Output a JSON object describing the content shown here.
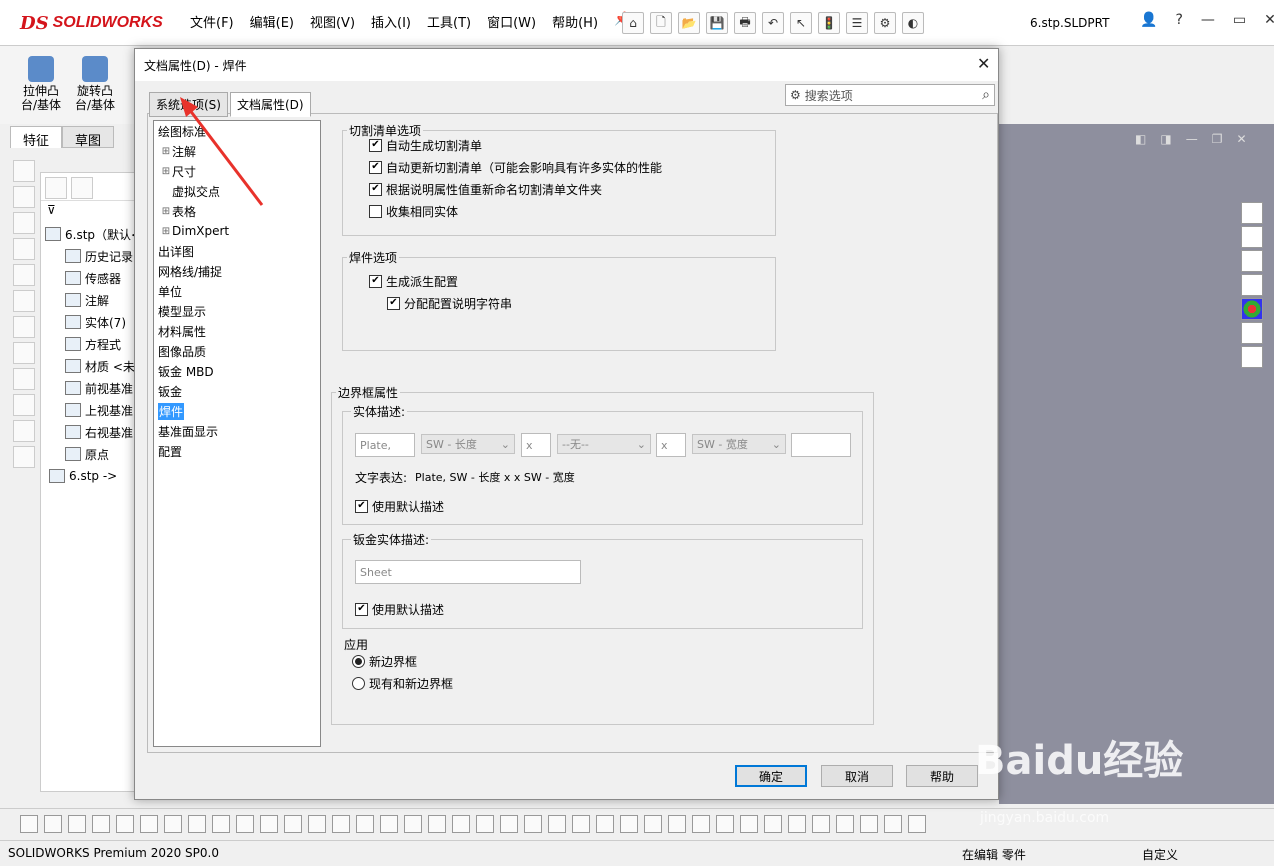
{
  "app": {
    "logo_ds": "DS",
    "logo_text": "SOLIDWORKS",
    "menu": [
      "文件(F)",
      "编辑(E)",
      "视图(V)",
      "插入(I)",
      "工具(T)",
      "窗口(W)",
      "帮助(H)"
    ],
    "doc_title": "6.stp.SLDPRT",
    "commands": [
      {
        "label1": "拉伸凸",
        "label2": "台/基体"
      },
      {
        "label1": "旋转凸",
        "label2": "台/基体"
      }
    ],
    "tabs": [
      "特征",
      "草图"
    ],
    "tree": [
      {
        "label": "6.stp（默认<",
        "icon": "part-icon"
      },
      {
        "label": "历史记录",
        "icon": "history-icon"
      },
      {
        "label": "传感器",
        "icon": "sensor-icon"
      },
      {
        "label": "注解",
        "icon": "annotation-icon"
      },
      {
        "label": "实体(7)",
        "icon": "solid-bodies-icon"
      },
      {
        "label": "方程式",
        "icon": "equation-icon"
      },
      {
        "label": "材质 <未",
        "icon": "material-icon"
      },
      {
        "label": "前视基准",
        "icon": "plane-icon"
      },
      {
        "label": "上视基准",
        "icon": "plane-icon"
      },
      {
        "label": "右视基准",
        "icon": "plane-icon"
      },
      {
        "label": "原点",
        "icon": "origin-icon"
      },
      {
        "label": "6.stp ->",
        "icon": "imported-part-icon"
      }
    ],
    "status": {
      "product": "SOLIDWORKS Premium 2020 SP0.0",
      "editing": "在编辑 零件",
      "custom": "自定义"
    }
  },
  "dialog": {
    "title": "文档属性(D) - 焊件",
    "close": "✕",
    "tabs": [
      "系统选项(S)",
      "文档属性(D)"
    ],
    "search_placeholder": "搜索选项",
    "nav": [
      {
        "label": "绘图标准",
        "exp": ""
      },
      {
        "label": "注解",
        "exp": "⊞"
      },
      {
        "label": "尺寸",
        "exp": "⊞"
      },
      {
        "label": "虚拟交点",
        "exp": ""
      },
      {
        "label": "表格",
        "exp": "⊞"
      },
      {
        "label": "DimXpert",
        "exp": "⊞"
      },
      {
        "label": "出详图",
        "exp": ""
      },
      {
        "label": "网格线/捕捉",
        "exp": ""
      },
      {
        "label": "单位",
        "exp": ""
      },
      {
        "label": "模型显示",
        "exp": ""
      },
      {
        "label": "材料属性",
        "exp": ""
      },
      {
        "label": "图像品质",
        "exp": ""
      },
      {
        "label": "钣金 MBD",
        "exp": ""
      },
      {
        "label": "钣金",
        "exp": ""
      },
      {
        "label": "焊件",
        "exp": "",
        "selected": true
      },
      {
        "label": "基准面显示",
        "exp": ""
      },
      {
        "label": "配置",
        "exp": ""
      }
    ],
    "cutlist": {
      "title": "切割清单选项",
      "items": [
        {
          "label": "自动生成切割清单",
          "checked": true
        },
        {
          "label": "自动更新切割清单（可能会影响具有许多实体的性能",
          "checked": true
        },
        {
          "label": "根据说明属性值重新命名切割清单文件夹",
          "checked": true
        },
        {
          "label": "收集相同实体",
          "checked": false
        }
      ]
    },
    "weld": {
      "title": "焊件选项",
      "items": [
        {
          "label": "生成派生配置",
          "checked": true
        },
        {
          "label": "分配配置说明字符串",
          "checked": true
        }
      ]
    },
    "bbox": {
      "title": "边界框属性",
      "solid_desc": {
        "title": "实体描述:",
        "field1": "Plate,",
        "dd1": "SW - 长度",
        "x1": "x",
        "dd2": "--无--",
        "x2": "x",
        "dd3": "SW - 宽度",
        "field_last": "",
        "text_expr_label": "文字表达:",
        "text_expr_value": "Plate, SW - 长度 x x SW - 宽度",
        "use_default": "使用默认描述",
        "use_default_checked": true
      },
      "sheet_desc": {
        "title": "钣金实体描述:",
        "field": "Sheet",
        "use_default": "使用默认描述",
        "use_default_checked": true
      },
      "apply": {
        "title": "应用",
        "options": [
          {
            "label": "新边界框",
            "selected": true
          },
          {
            "label": "现有和新边界框",
            "selected": false
          }
        ]
      }
    },
    "buttons": {
      "ok": "确定",
      "cancel": "取消",
      "help": "帮助"
    }
  },
  "watermark": {
    "main": "Baidu经验",
    "sub": "jingyan.baidu.com"
  },
  "colors": {
    "selection": "#3399ff",
    "annotation_arrow": "#e8322b",
    "viewport_bg": "#8e8f9e",
    "brand": "#d4141b"
  }
}
